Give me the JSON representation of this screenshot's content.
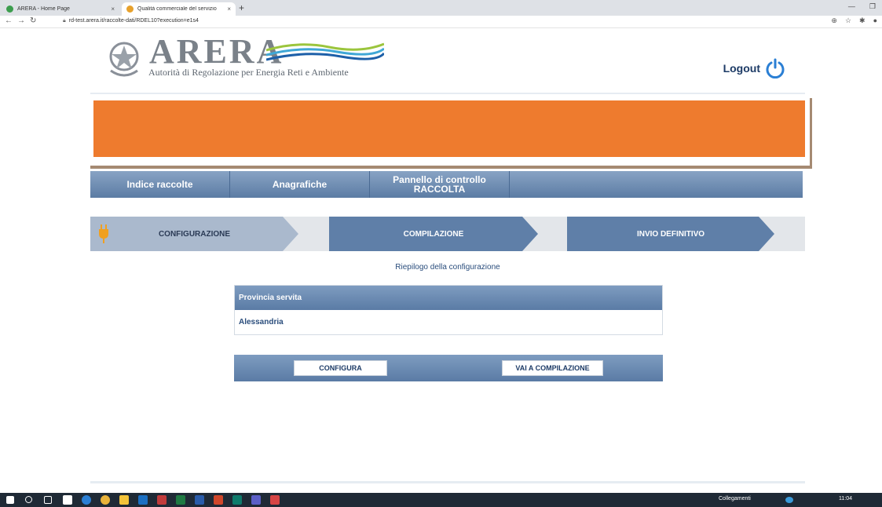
{
  "browser": {
    "tabs": [
      {
        "title": "ARERA - Home Page",
        "active": false
      },
      {
        "title": "Qualità commerciale del servizio",
        "active": true
      }
    ],
    "new_tab_label": "+",
    "url": "rd-test.arera.it/raccolte-dati/RDEL10?execution=e1s4"
  },
  "header": {
    "logo_text": "ARERA",
    "logo_subtitle": "Autorità di Regolazione per Energia Reti e Ambiente",
    "logout_label": "Logout"
  },
  "menu": {
    "items": [
      {
        "label": "Indice raccolte"
      },
      {
        "label": "Anagrafiche"
      },
      {
        "label_line1": "Pannello di controllo",
        "label_line2": "RACCOLTA"
      }
    ]
  },
  "steps": [
    {
      "label": "CONFIGURAZIONE"
    },
    {
      "label": "COMPILAZIONE"
    },
    {
      "label": "INVIO DEFINITIVO"
    }
  ],
  "summary": {
    "title": "Riepilogo della configurazione",
    "column_header": "Provincia servita",
    "value": "Alessandria"
  },
  "actions": {
    "configura_label": "CONFIGURA",
    "compilazione_label": "VAI A COMPILAZIONE"
  },
  "taskbar": {
    "links_label": "Collegamenti",
    "time": "11:04"
  },
  "colors": {
    "banner": "#ee7b2e",
    "menu_blue": "#5c7ca4",
    "text_blue": "#2a4d7c"
  }
}
